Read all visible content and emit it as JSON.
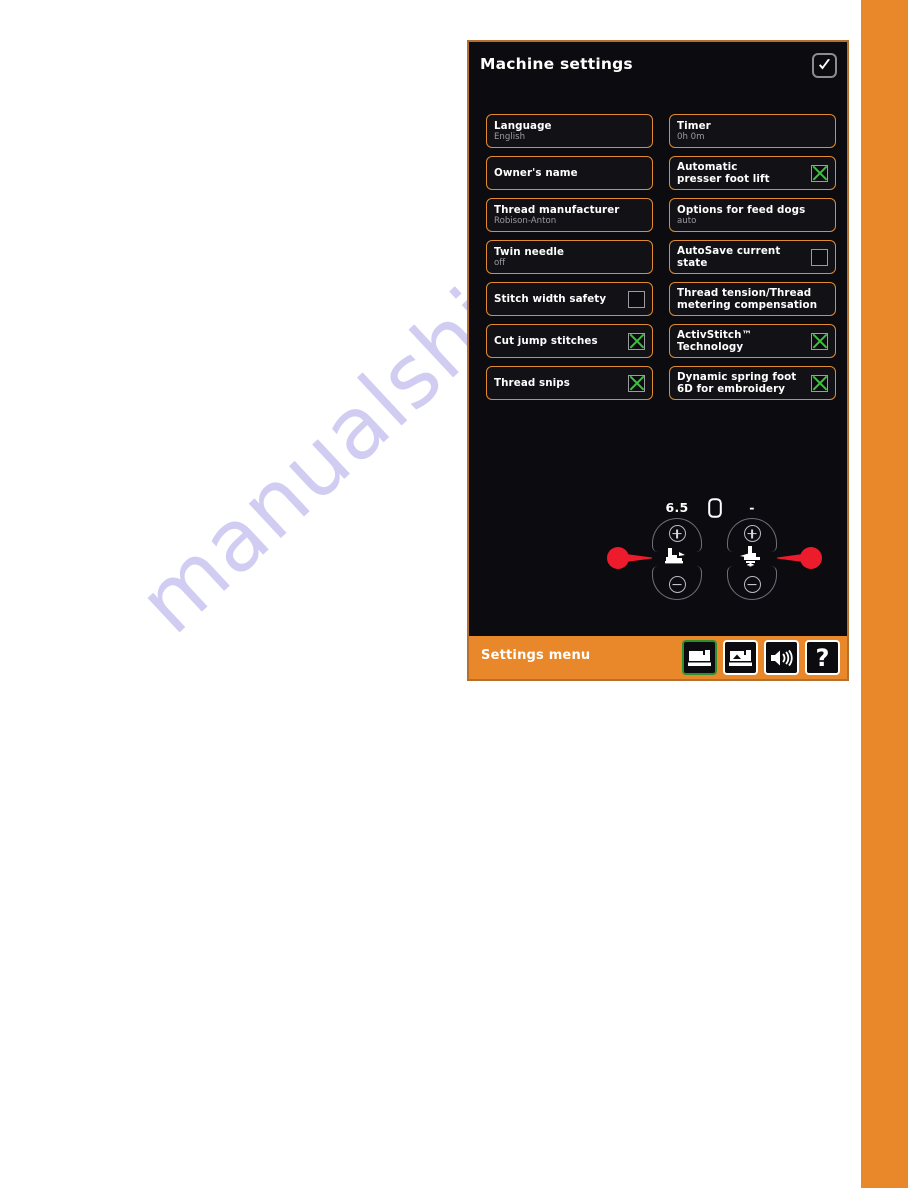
{
  "screen": {
    "title": "Machine settings",
    "ok_button": "ok-check",
    "settings": [
      {
        "label": "Language",
        "value": "English",
        "control": "none"
      },
      {
        "label": "Timer",
        "value": "0h  0m",
        "control": "none"
      },
      {
        "label": "Owner's name",
        "value": "",
        "control": "none"
      },
      {
        "label": "Automatic\npresser foot lift",
        "value": "",
        "control": "checkbox",
        "checked": true
      },
      {
        "label": "Thread manufacturer",
        "value": "Robison-Anton",
        "control": "none"
      },
      {
        "label": "Options for feed dogs",
        "value": "auto",
        "control": "none"
      },
      {
        "label": "Twin needle",
        "value": "off",
        "control": "none"
      },
      {
        "label": "AutoSave current\nstate",
        "value": "",
        "control": "checkbox",
        "checked": false
      },
      {
        "label": "Stitch width safety",
        "value": "",
        "control": "checkbox",
        "checked": false
      },
      {
        "label": "Thread tension/Thread\nmetering compensation",
        "value": "",
        "control": "none"
      },
      {
        "label": "Cut jump stitches",
        "value": "",
        "control": "checkbox",
        "checked": true
      },
      {
        "label": "ActivStitch™\nTechnology",
        "value": "",
        "control": "checkbox",
        "checked": true
      },
      {
        "label": "Thread snips",
        "value": "",
        "control": "checkbox",
        "checked": true
      },
      {
        "label": "Dynamic spring foot\n6D for embroidery",
        "value": "",
        "control": "checkbox",
        "checked": true
      }
    ],
    "steppers": [
      {
        "name": "presser-foot-height",
        "value": "6.5",
        "plus": "+",
        "minus": "-"
      },
      {
        "name": "presser-foot-pressure",
        "value": "-",
        "plus": "+",
        "minus": "-"
      }
    ],
    "bottom_bar": {
      "label": "Settings menu",
      "icons": [
        {
          "name": "machine-settings-icon",
          "selected": true
        },
        {
          "name": "embroidery-settings-icon",
          "selected": false
        },
        {
          "name": "sound-settings-icon",
          "selected": false
        },
        {
          "name": "help-icon",
          "selected": false,
          "glyph": "?"
        }
      ]
    }
  },
  "watermark": {
    "text": "manualshive.com"
  },
  "colors": {
    "accent_orange": "#e8882a",
    "button_border": "#e08a32",
    "screen_bg": "#0c0c10",
    "checked_green": "#3fbf3f",
    "balloon_red": "#ec1c2d",
    "selected_border": "#2f8f2f"
  }
}
